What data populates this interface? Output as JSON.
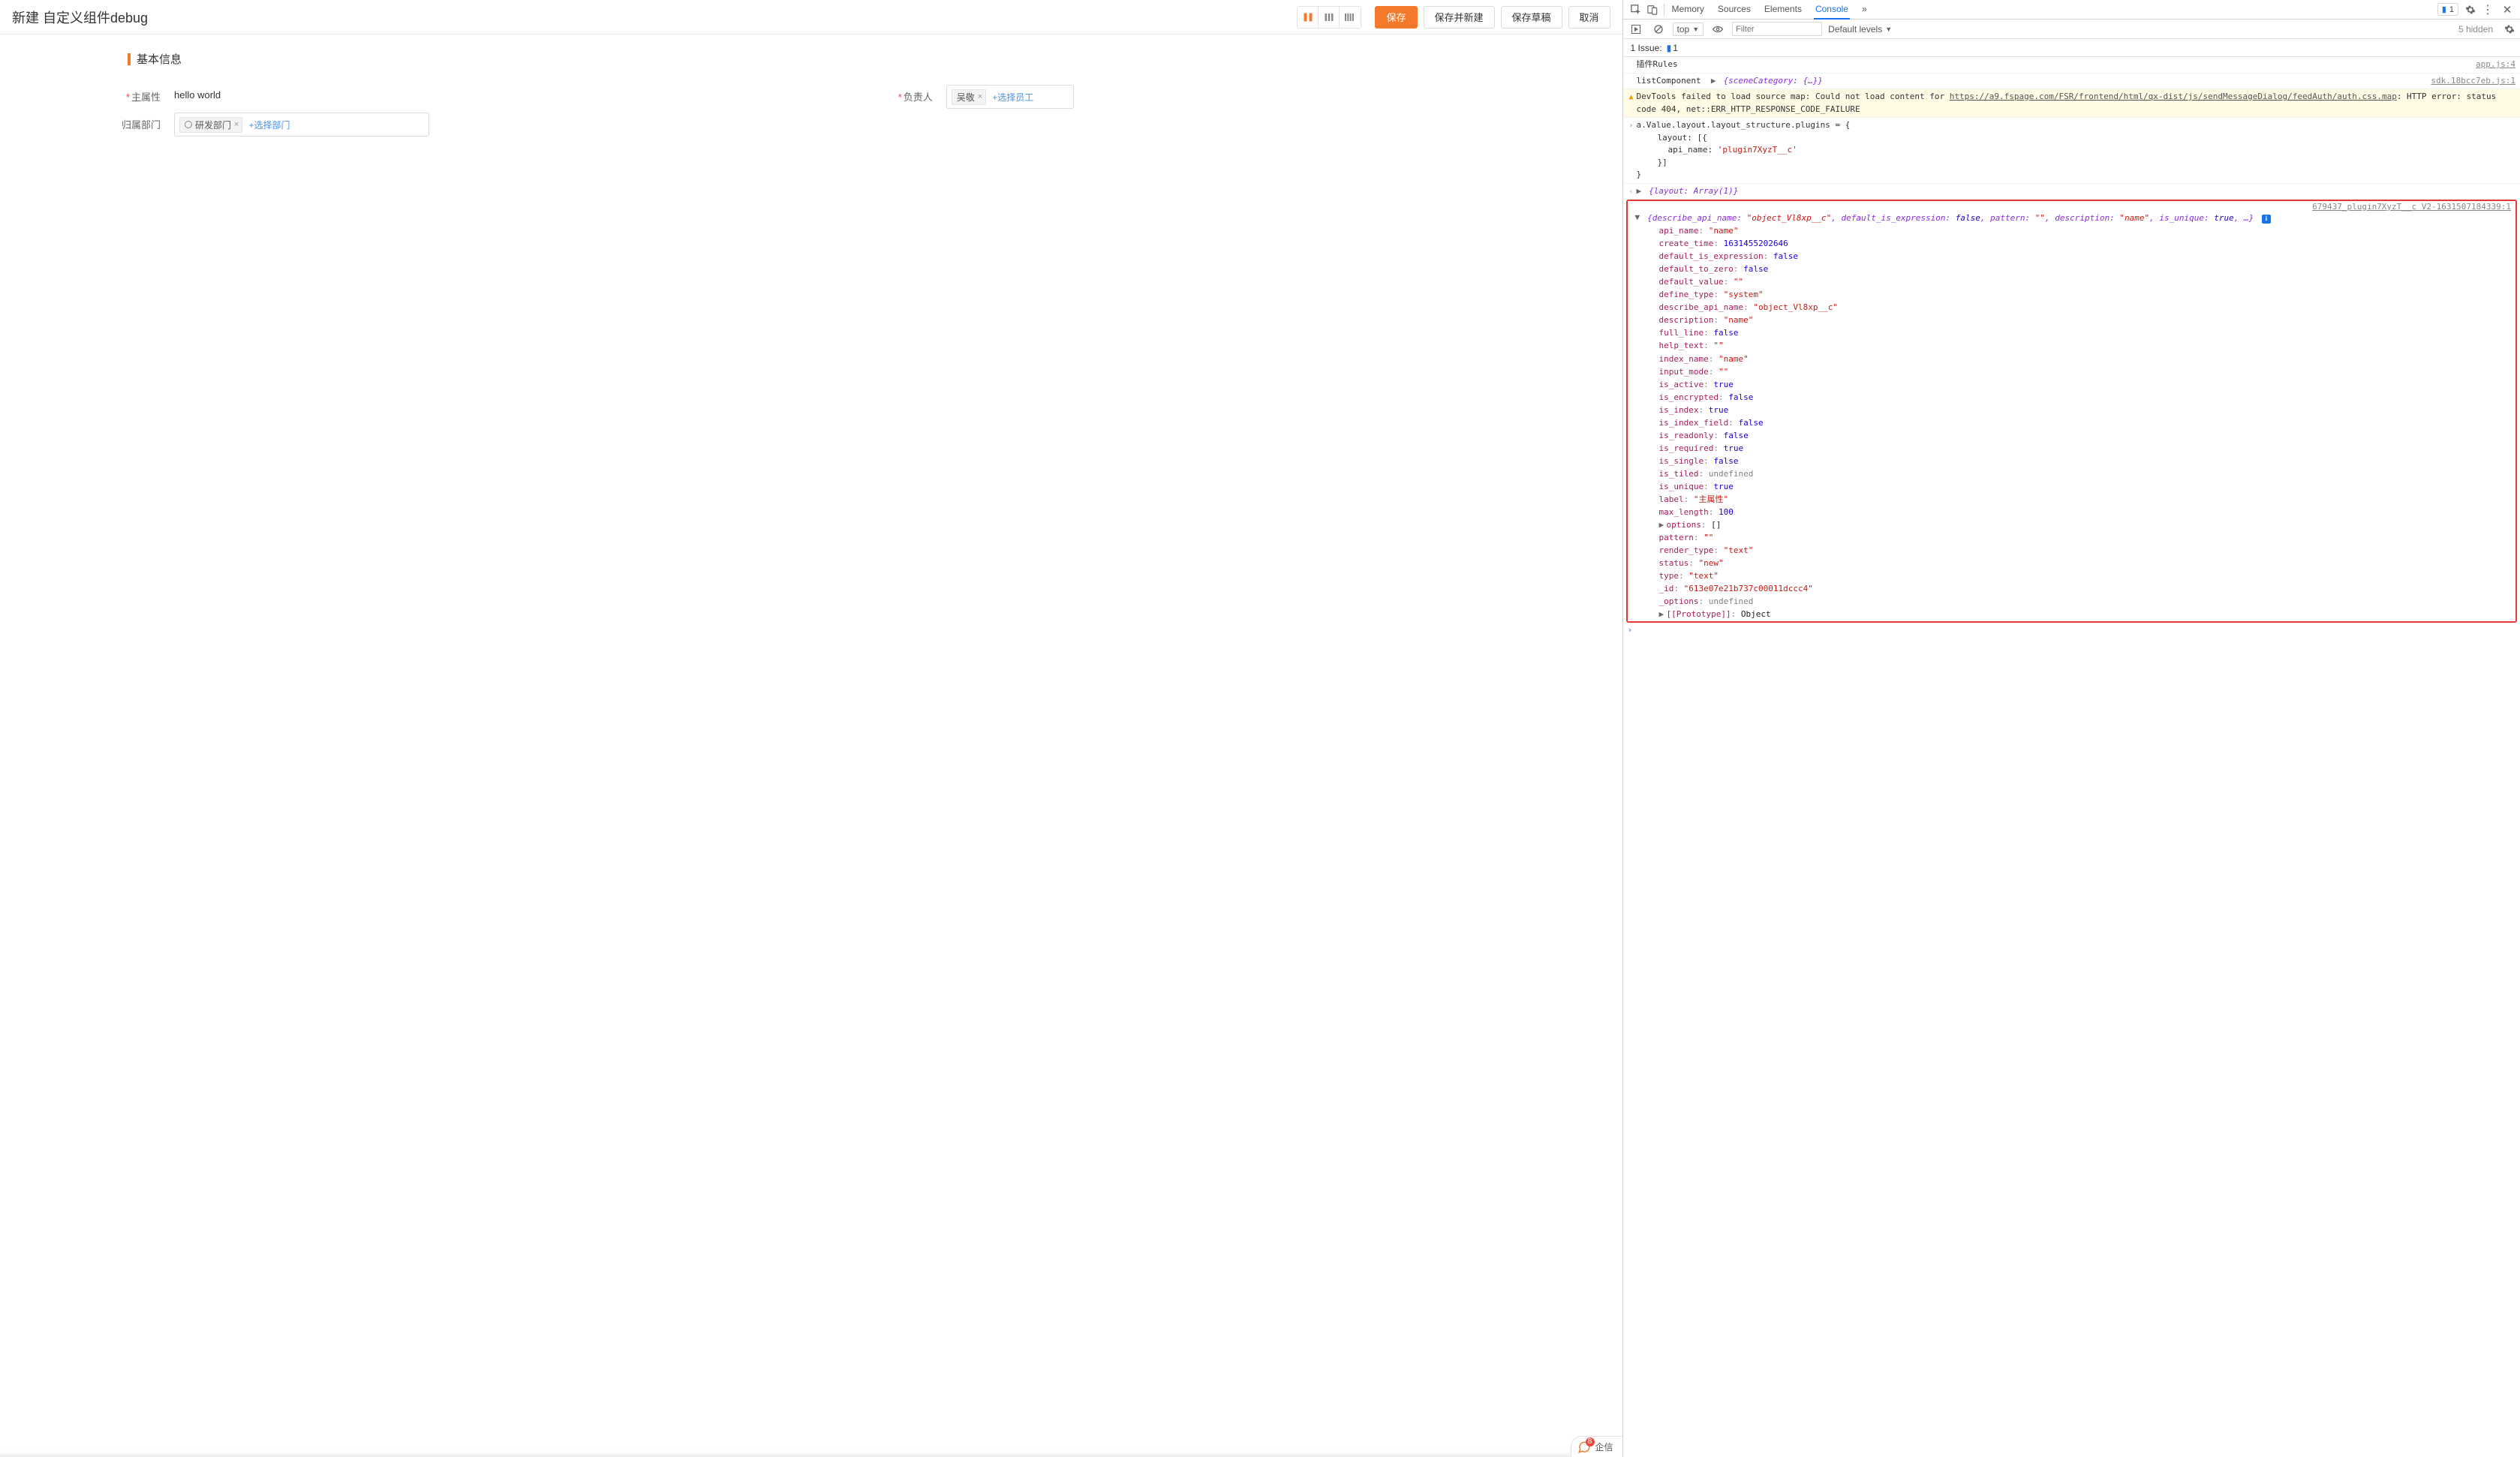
{
  "app": {
    "title": "新建 自定义组件debug",
    "buttons": {
      "save": "保存",
      "save_new": "保存并新建",
      "save_draft": "保存草稿",
      "cancel": "取消"
    },
    "section_basic": "基本信息",
    "labels": {
      "main_attr": "主属性",
      "owner": "负责人",
      "department": "归属部门"
    },
    "values": {
      "main_attr": "hello world"
    },
    "owner_chip": "吴敬",
    "add_employee": "+选择员工",
    "dept_chip": "研发部门",
    "add_department": "+选择部门",
    "qixin": {
      "label": "企信",
      "badge": "8"
    }
  },
  "devtools": {
    "tabs": {
      "memory": "Memory",
      "sources": "Sources",
      "elements": "Elements",
      "console": "Console",
      "more": "»"
    },
    "issue_pill": "1",
    "subbar": {
      "context": "top",
      "filter_placeholder": "Filter",
      "levels": "Default levels",
      "hidden": "5 hidden"
    },
    "issuebar": {
      "label": "1 Issue:",
      "count": "1"
    },
    "log1": {
      "text": "插件Rules",
      "src": "app.js:4"
    },
    "log2": {
      "pre": "listComponent",
      "obj": "{sceneCategory: {…}}",
      "src": "sdk.18bcc7eb.js:1"
    },
    "warn": {
      "pre": "DevTools failed to load source map: Could not load content for ",
      "link": "https://a9.fspage.com/FSR/frontend/html/qx-dist/js/sendMessageDialog/feedAuth/auth.css.map",
      "post": ": HTTP error: status code 404, net::ERR_HTTP_RESPONSE_CODE_FAILURE"
    },
    "assign": {
      "l1": "a.Value.layout.layout_structure.plugins = {",
      "l2": "layout: [{",
      "l3k": "api_name:",
      "l3v": "'plugin7XyzT__c'",
      "l4": "}]",
      "l5": "}"
    },
    "result": {
      "text": "{layout: Array(1)}"
    },
    "redbox": {
      "src": "679437_plugin7XyzT__c V2-1631507184339:1",
      "summary_a": "{describe_api_name: ",
      "summary_av": "\"object_Vl8xp__c\"",
      "summary_b": ", default_is_expression: ",
      "summary_bv": "false",
      "summary_c": ", pattern: ",
      "summary_cv": "\"\"",
      "summary_d": ", description: ",
      "summary_dv": "\"name\"",
      "summary_e": ", is_unique: ",
      "summary_ev": "true",
      "summary_tail": ", …}",
      "props": [
        {
          "k": "api_name",
          "v": "\"name\"",
          "t": "str"
        },
        {
          "k": "create_time",
          "v": "1631455202646",
          "t": "num"
        },
        {
          "k": "default_is_expression",
          "v": "false",
          "t": "bool"
        },
        {
          "k": "default_to_zero",
          "v": "false",
          "t": "bool"
        },
        {
          "k": "default_value",
          "v": "\"\"",
          "t": "str"
        },
        {
          "k": "define_type",
          "v": "\"system\"",
          "t": "str"
        },
        {
          "k": "describe_api_name",
          "v": "\"object_Vl8xp__c\"",
          "t": "str"
        },
        {
          "k": "description",
          "v": "\"name\"",
          "t": "str"
        },
        {
          "k": "full_line",
          "v": "false",
          "t": "bool"
        },
        {
          "k": "help_text",
          "v": "\"\"",
          "t": "str"
        },
        {
          "k": "index_name",
          "v": "\"name\"",
          "t": "str"
        },
        {
          "k": "input_mode",
          "v": "\"\"",
          "t": "str"
        },
        {
          "k": "is_active",
          "v": "true",
          "t": "bool"
        },
        {
          "k": "is_encrypted",
          "v": "false",
          "t": "bool"
        },
        {
          "k": "is_index",
          "v": "true",
          "t": "bool"
        },
        {
          "k": "is_index_field",
          "v": "false",
          "t": "bool"
        },
        {
          "k": "is_readonly",
          "v": "false",
          "t": "bool"
        },
        {
          "k": "is_required",
          "v": "true",
          "t": "bool"
        },
        {
          "k": "is_single",
          "v": "false",
          "t": "bool"
        },
        {
          "k": "is_tiled",
          "v": "undefined",
          "t": "undef"
        },
        {
          "k": "is_unique",
          "v": "true",
          "t": "bool"
        },
        {
          "k": "label",
          "v": "\"主属性\"",
          "t": "str"
        },
        {
          "k": "max_length",
          "v": "100",
          "t": "num"
        },
        {
          "k": "options",
          "v": "[]",
          "t": "obj",
          "exp": true
        },
        {
          "k": "pattern",
          "v": "\"\"",
          "t": "str"
        },
        {
          "k": "render_type",
          "v": "\"text\"",
          "t": "str"
        },
        {
          "k": "status",
          "v": "\"new\"",
          "t": "str"
        },
        {
          "k": "type",
          "v": "\"text\"",
          "t": "str"
        },
        {
          "k": "_id",
          "v": "\"613e07e21b737c00011dccc4\"",
          "t": "str"
        },
        {
          "k": "_options",
          "v": "undefined",
          "t": "undef"
        }
      ],
      "proto_k": "[[Prototype]]",
      "proto_v": "Object"
    }
  }
}
